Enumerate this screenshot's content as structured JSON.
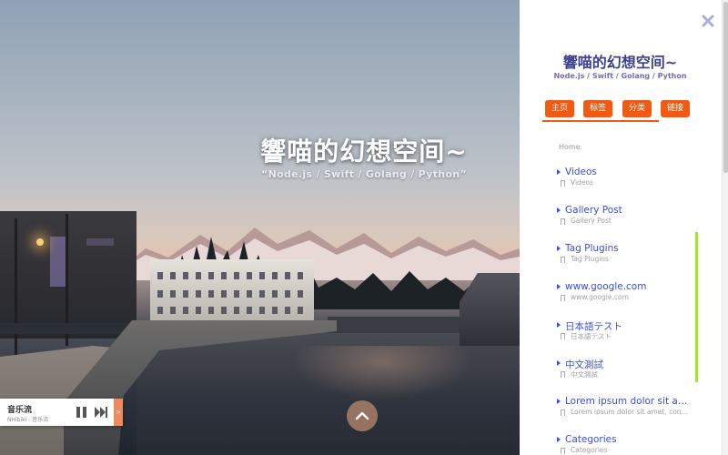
{
  "hero": {
    "title": "響喵的幻想空间~",
    "subtitle": "“Node.js / Swift / Golang / Python”"
  },
  "player": {
    "title": "音乐流",
    "subtitle": "NHibiki - 音乐流",
    "toggle_glyph": ">"
  },
  "sidebar": {
    "title": "響喵的幻想空间~",
    "subtitle": "Node.js / Swift / Golang / Python",
    "nav": [
      {
        "label": "主页"
      },
      {
        "label": "标签"
      },
      {
        "label": "分类"
      },
      {
        "label": "链接"
      }
    ],
    "home_label": "Home",
    "items": [
      {
        "title": "Videos",
        "sub": "Videos"
      },
      {
        "title": "Gallery Post",
        "sub": "Gallery Post"
      },
      {
        "title": "Tag Plugins",
        "sub": "Tag Plugins"
      },
      {
        "title": "www.google.com",
        "sub": "www.google.com"
      },
      {
        "title": "日本語テスト",
        "sub": "日本語テスト"
      },
      {
        "title": "中文測試",
        "sub": "中文測試"
      },
      {
        "title": "Lorem ipsum dolor sit amet...",
        "sub": "Lorem ipsum dolor sit amet, con..."
      },
      {
        "title": "Categories",
        "sub": "Categories"
      }
    ]
  },
  "colors": {
    "accent_orange": "#f25a12",
    "link_blue": "#3b4fd8",
    "title_purple": "#3a3f8f",
    "scroll_green": "#a6e22e"
  },
  "icons": {
    "close": "close-icon",
    "up": "chevron-up-icon",
    "pause": "pause-icon",
    "next": "next-track-icon",
    "arrow": "caret-right-icon",
    "bookmark": "bookmark-icon"
  }
}
